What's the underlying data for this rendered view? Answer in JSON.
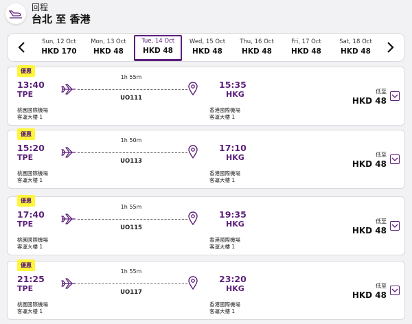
{
  "header": {
    "subtitle": "回程",
    "title": "台北 至 香港"
  },
  "accent": "#5b1f7a",
  "badge_color": "#fff53a",
  "date_bar": {
    "prev_icon": "chevron-left-icon",
    "next_icon": "chevron-right-icon",
    "dates": [
      {
        "date": "Sun, 12 Oct",
        "price": "HKD 170",
        "selected": false
      },
      {
        "date": "Mon, 13 Oct",
        "price": "HKD 48",
        "selected": false
      },
      {
        "date": "Tue, 14 Oct",
        "price": "HKD 48",
        "selected": true
      },
      {
        "date": "Wed, 15 Oct",
        "price": "HKD 48",
        "selected": false
      },
      {
        "date": "Thu, 16 Oct",
        "price": "HKD 48",
        "selected": false
      },
      {
        "date": "Fri, 17 Oct",
        "price": "HKD 48",
        "selected": false
      },
      {
        "date": "Sat, 18 Oct",
        "price": "HKD 48",
        "selected": false
      }
    ]
  },
  "flights": [
    {
      "badge": "優惠",
      "dep_time": "13:40",
      "dep_code": "TPE",
      "dep_airport_1": "桃園國際機場",
      "dep_airport_2": "客運大樓 1",
      "duration": "1h 55m",
      "flight_no": "UO111",
      "arr_time": "15:35",
      "arr_code": "HKG",
      "arr_airport_1": "香港國際機場",
      "arr_airport_2": "客運大樓 1",
      "from_label": "低至",
      "price": "HKD 48"
    },
    {
      "badge": "優惠",
      "dep_time": "15:20",
      "dep_code": "TPE",
      "dep_airport_1": "桃園國際機場",
      "dep_airport_2": "客運大樓 1",
      "duration": "1h 50m",
      "flight_no": "UO113",
      "arr_time": "17:10",
      "arr_code": "HKG",
      "arr_airport_1": "香港國際機場",
      "arr_airport_2": "客運大樓 1",
      "from_label": "低至",
      "price": "HKD 48"
    },
    {
      "badge": "優惠",
      "dep_time": "17:40",
      "dep_code": "TPE",
      "dep_airport_1": "桃園國際機場",
      "dep_airport_2": "客運大樓 1",
      "duration": "1h 55m",
      "flight_no": "UO115",
      "arr_time": "19:35",
      "arr_code": "HKG",
      "arr_airport_1": "香港國際機場",
      "arr_airport_2": "客運大樓 1",
      "from_label": "低至",
      "price": "HKD 48"
    },
    {
      "badge": "優惠",
      "dep_time": "21:25",
      "dep_code": "TPE",
      "dep_airport_1": "桃園國際機場",
      "dep_airport_2": "客運大樓 1",
      "duration": "1h 55m",
      "flight_no": "UO117",
      "arr_time": "23:20",
      "arr_code": "HKG",
      "arr_airport_1": "香港國際機場",
      "arr_airport_2": "客運大樓 1",
      "from_label": "低至",
      "price": "HKD 48"
    }
  ]
}
